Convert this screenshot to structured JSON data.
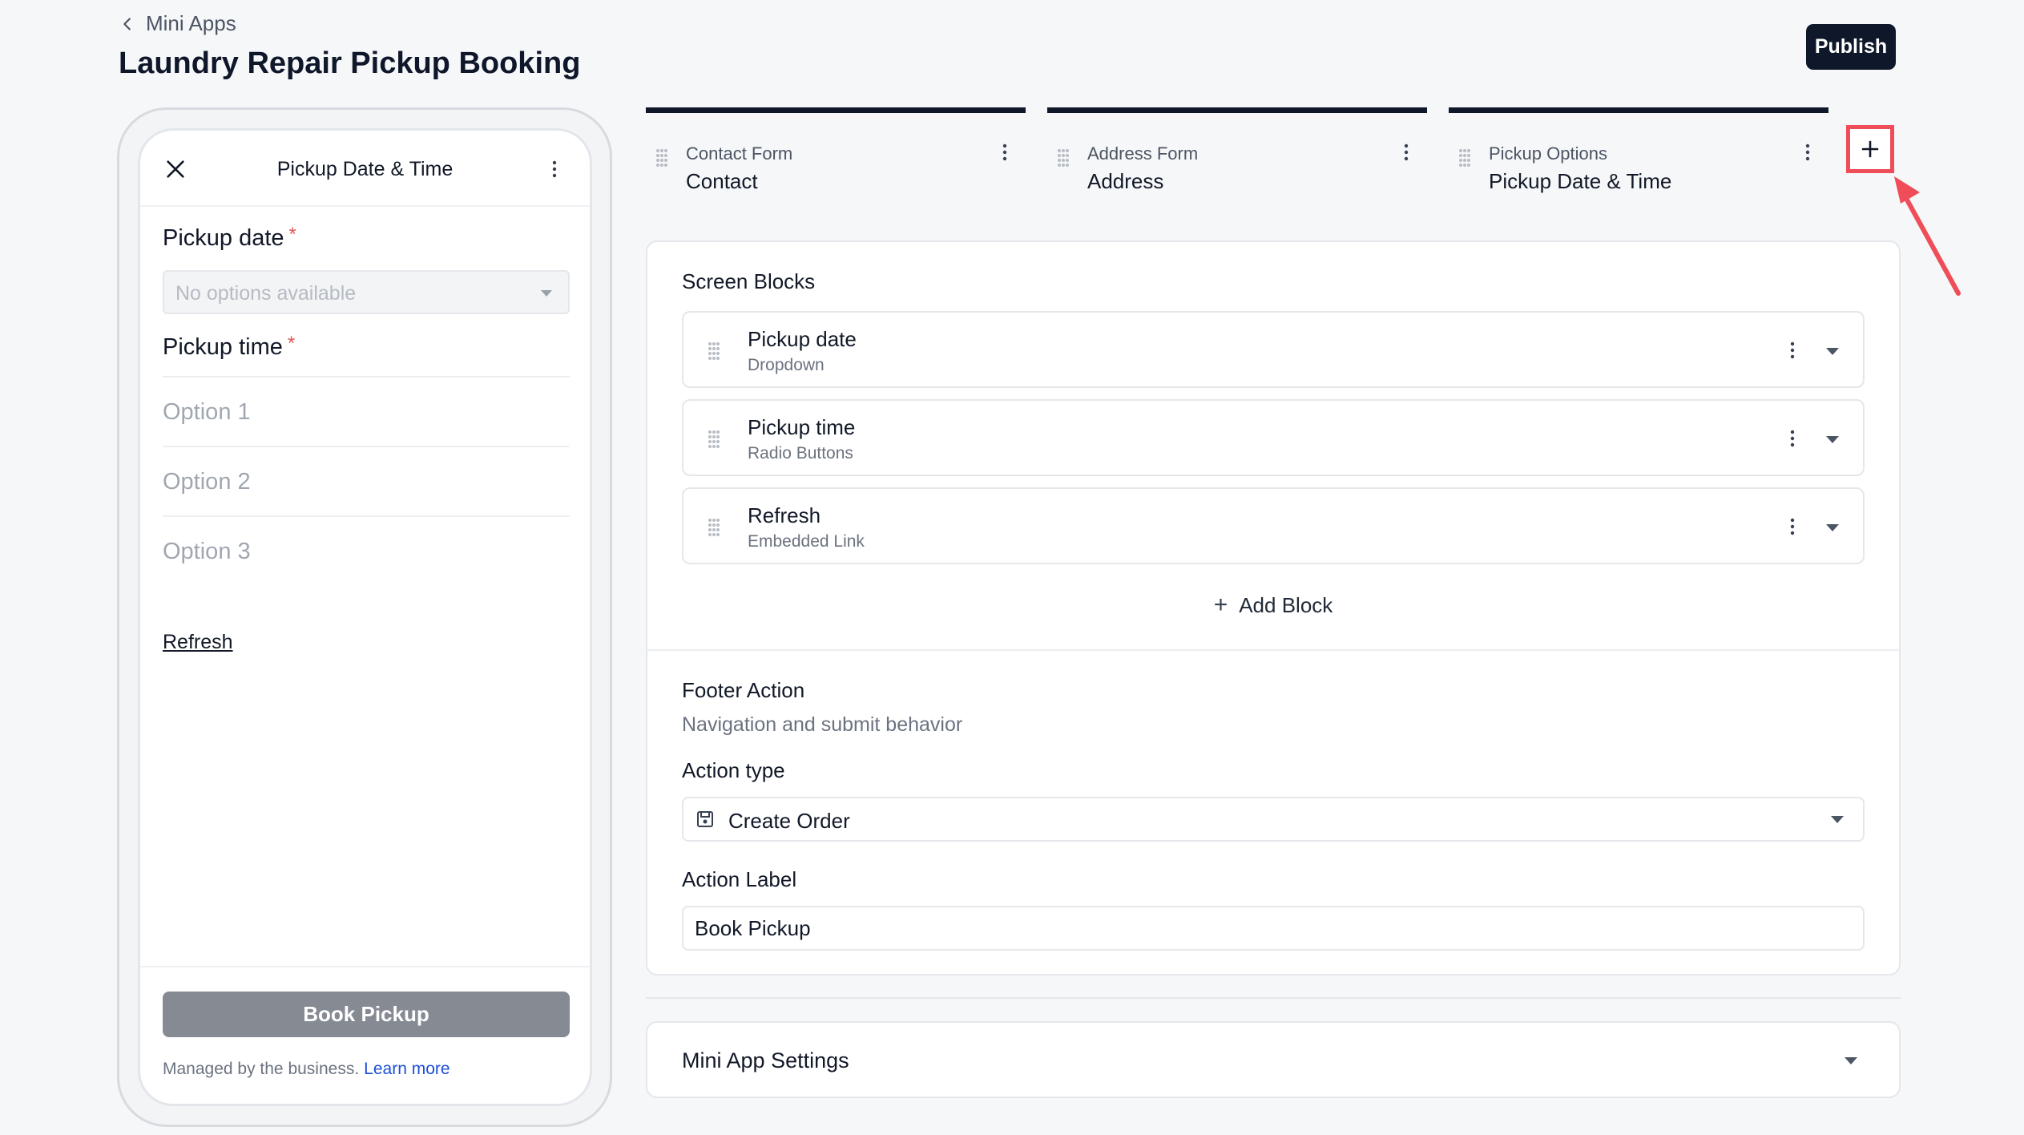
{
  "breadcrumb": {
    "label": "Mini Apps"
  },
  "page": {
    "title": "Laundry Repair Pickup Booking"
  },
  "toolbar": {
    "publish_label": "Publish"
  },
  "preview": {
    "title": "Pickup Date & Time",
    "fields": [
      {
        "label": "Pickup date",
        "required_mark": "*",
        "placeholder": "No options available"
      },
      {
        "label": "Pickup time",
        "required_mark": "*",
        "options": [
          "Option 1",
          "Option 2",
          "Option 3"
        ]
      }
    ],
    "link_label": "Refresh",
    "submit_label": "Book Pickup",
    "managed_text": "Managed by the business.",
    "learn_more": "Learn more"
  },
  "tabs": [
    {
      "category": "Contact Form",
      "name": "Contact"
    },
    {
      "category": "Address Form",
      "name": "Address"
    },
    {
      "category": "Pickup Options",
      "name": "Pickup Date & Time"
    }
  ],
  "blocks": {
    "title": "Screen Blocks",
    "items": [
      {
        "name": "Pickup date",
        "type": "Dropdown"
      },
      {
        "name": "Pickup time",
        "type": "Radio Buttons"
      },
      {
        "name": "Refresh",
        "type": "Embedded Link"
      }
    ],
    "add_label": "Add Block"
  },
  "footer_action": {
    "title": "Footer Action",
    "subtitle": "Navigation and submit behavior",
    "action_type_label": "Action type",
    "action_type_value": "Create Order",
    "action_label_label": "Action Label",
    "action_label_value": "Book Pickup"
  },
  "settings": {
    "title": "Mini App Settings"
  },
  "colors": {
    "primary": "#0f172a",
    "annotation": "#ef4d58",
    "disabled_button": "#868a93",
    "link": "#1d4ed8"
  }
}
